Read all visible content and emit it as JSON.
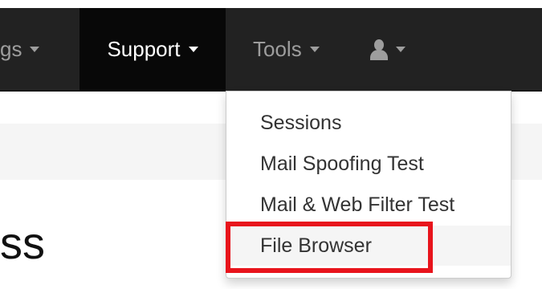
{
  "navbar": {
    "items": [
      {
        "label": "gs",
        "caret": true
      },
      {
        "label": "Support",
        "caret": true
      },
      {
        "label": "Tools",
        "caret": true
      },
      {
        "icon": "user-icon",
        "caret": true
      }
    ],
    "active": "Support"
  },
  "dropdown": {
    "items": [
      {
        "label": "Sessions"
      },
      {
        "label": "Mail Spoofing Test"
      },
      {
        "label": "Mail & Web Filter Test"
      },
      {
        "label": "File Browser",
        "hovered": true
      }
    ]
  },
  "page": {
    "heading_fragment": "ss"
  },
  "colors": {
    "navbar": "#222222",
    "navbar_active": "#080808",
    "navbar_text": "#9d9d9d",
    "breadcrumb_bg": "#f5f5f5",
    "highlight": "#e8141c"
  }
}
